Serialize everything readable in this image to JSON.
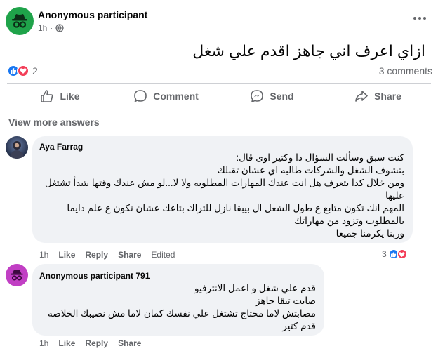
{
  "post": {
    "author": "Anonymous participant",
    "time": "1h",
    "text": "ازاي اعرف اني جاهز اقدم علي شغل",
    "reaction_count": "2",
    "comments_count": "3 comments"
  },
  "actions": {
    "like": "Like",
    "comment": "Comment",
    "send": "Send",
    "share": "Share"
  },
  "view_more": "View more answers",
  "comments": [
    {
      "author": "Aya Farrag",
      "lines": [
        "كنت سبق وسألت السؤال دا وكتير اوى قال:",
        "بتشوف الشغل والشركات طالبه اي عشان تقبلك",
        "ومن خلال كدا بتعرف هل انت عندك المهارات المطلوبه ولا لا...لو مش عندك وقتها بتبدأ تشتغل",
        "عليها",
        "المهم انك تكون متابع ع طول الشغل ال بيبقا نازل للتراك بتاعك عشان تكون ع علم دايما",
        "بالمطلوب وتزود من مهاراتك",
        "وربنا يكرمنا جميعا"
      ],
      "time": "1h",
      "like": "Like",
      "reply": "Reply",
      "share": "Share",
      "edited": "Edited",
      "reaction_count": "3"
    },
    {
      "author": "Anonymous participant 791",
      "lines": [
        "قدم علي شغل و اعمل الانترفيو",
        "صابت تبقا جاهز",
        "مصابتش لاما محتاج تشتغل علي نفسك كمان لاما مش نصيبك الخلاصه",
        "قدم كتير"
      ],
      "time": "1h",
      "like": "Like",
      "reply": "Reply",
      "share": "Share"
    }
  ],
  "colors": {
    "anon_avatar": "#1fa34a",
    "anon_avatar_2": "#c13fc4",
    "like_blue": "#1877f2",
    "love_red": "#f33e58"
  }
}
